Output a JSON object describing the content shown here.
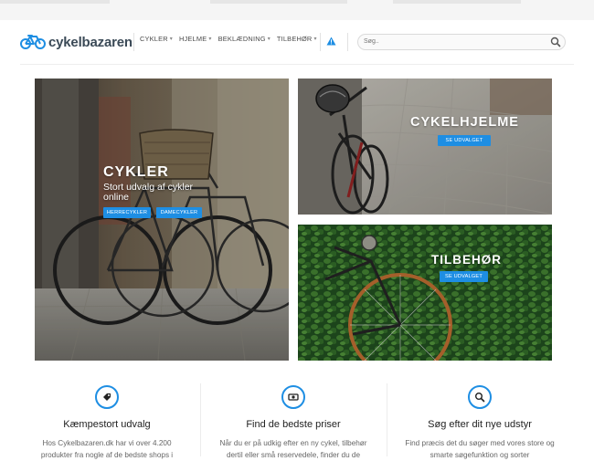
{
  "brand": {
    "name": "cykelbazaren",
    "accent": "#1e8ee3",
    "logo_color": "#3b4a57"
  },
  "nav": [
    {
      "label": "CYKLER",
      "icon": "chevron-down-icon"
    },
    {
      "label": "HJELME",
      "icon": "chevron-down-icon"
    },
    {
      "label": "BEKLÆDNING",
      "icon": "chevron-down-icon"
    },
    {
      "label": "TILBEHØR",
      "icon": "chevron-down-icon"
    }
  ],
  "search": {
    "placeholder": "Søg..",
    "icon": "search-icon"
  },
  "tiles": {
    "cykler": {
      "title": "CYKLER",
      "subtitle": "Stort udvalg af cykler online",
      "buttons": [
        "HERRECYKLER",
        "DAMECYKLER"
      ]
    },
    "hjelme": {
      "title": "CYKELHJELME",
      "button": "SE UDVALGET"
    },
    "tilbehor": {
      "title": "TILBEHØR",
      "button": "SE UDVALGET"
    }
  },
  "features": [
    {
      "icon": "tag-icon",
      "title": "Kæmpestort udvalg",
      "text": "Hos Cykelbazaren.dk har vi over 4.200 produkter fra nogle af de bedste shops i"
    },
    {
      "icon": "money-icon",
      "title": "Find de bedste priser",
      "text": "Når du er på udkig efter en ny cykel, tilbehør dertil eller små reservedele, finder du de"
    },
    {
      "icon": "search-icon",
      "title": "Søg efter dit nye udstyr",
      "text": "Find præcis det du søger med vores store og smarte søgefunktion og sorter"
    }
  ]
}
